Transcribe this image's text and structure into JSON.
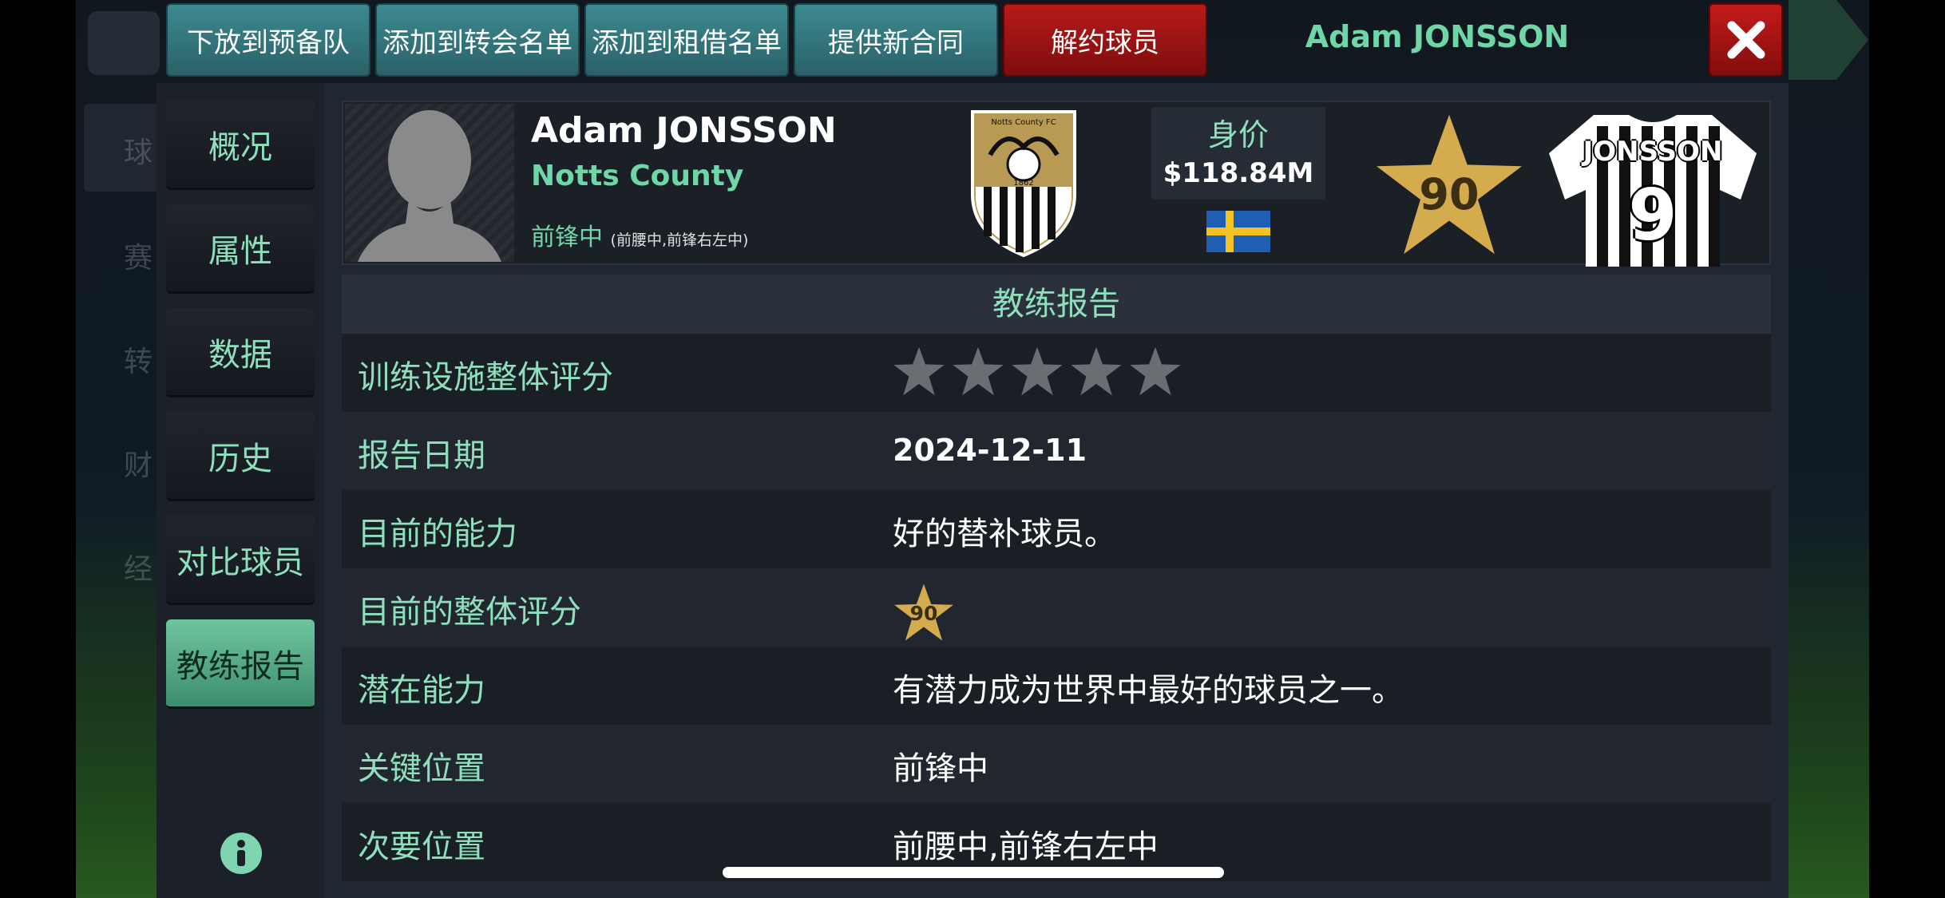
{
  "colors": {
    "accent": "#6fd6a8",
    "button_teal": "#2a6168",
    "button_red": "#a01414",
    "star_gold": "#d4ac4d"
  },
  "top_actions": [
    {
      "label": "下放到预备队"
    },
    {
      "label": "添加到转会名单"
    },
    {
      "label": "添加到租借名单"
    },
    {
      "label": "提供新合同"
    },
    {
      "label": "解约球员"
    }
  ],
  "header": {
    "player_name": "Adam JONSSON",
    "close_icon": "close-icon"
  },
  "sidebar": {
    "items": [
      {
        "label": "概况"
      },
      {
        "label": "属性"
      },
      {
        "label": "数据"
      },
      {
        "label": "历史"
      },
      {
        "label": "对比球员"
      },
      {
        "label": "教练报告",
        "active": true
      }
    ],
    "info_icon": "info-icon"
  },
  "player": {
    "name": "Adam JONSSON",
    "club": "Notts County",
    "main_position": "前锋中",
    "other_positions": "(前腰中,前锋右左中)",
    "value_label": "身价",
    "value": "$118.84M",
    "nationality_flag": "sweden-flag",
    "rating": "90",
    "shirt_name": "JONSSON",
    "shirt_number": "9",
    "crest_text": {
      "top": "Notts County FC",
      "year": "1862"
    }
  },
  "report": {
    "title": "教练报告",
    "rows": [
      {
        "label": "训练设施整体评分",
        "stars_filled": 0,
        "stars_total": 5
      },
      {
        "label": "报告日期",
        "value": "2024-12-11"
      },
      {
        "label": "目前的能力",
        "value": "好的替补球员。"
      },
      {
        "label": "目前的整体评分",
        "rating": "90"
      },
      {
        "label": "潜在能力",
        "value": "有潜力成为世界中最好的球员之一。"
      },
      {
        "label": "关键位置",
        "value": "前锋中"
      },
      {
        "label": "次要位置",
        "value": "前腰中,前锋右左中"
      }
    ]
  },
  "background_ghost": {
    "items": [
      "球",
      "赛",
      "转",
      "财",
      "经"
    ]
  }
}
